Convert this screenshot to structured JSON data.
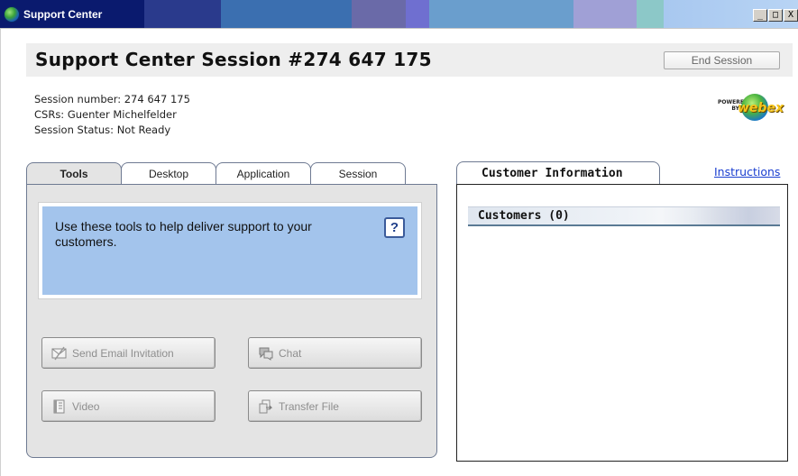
{
  "window": {
    "title": "Support Center",
    "controls": [
      "_",
      "□",
      "X"
    ]
  },
  "header": {
    "title": "Support Center Session #274 647 175",
    "end_session_label": "End Session"
  },
  "session_info": {
    "number_line": "Session number: 274 647 175",
    "csrs_line": "CSRs: Guenter Michelfelder",
    "status_line": "Session Status: Not Ready"
  },
  "logo": {
    "powered": "POWERED BY",
    "brand": "webex"
  },
  "left_tabs": [
    {
      "label": "Tools",
      "active": true
    },
    {
      "label": "Desktop",
      "active": false
    },
    {
      "label": "Application",
      "active": false
    },
    {
      "label": "Session",
      "active": false
    }
  ],
  "tools": {
    "help_text": "Use these tools to help deliver support to your customers.",
    "help_icon": "?",
    "buttons": {
      "email": "Send Email Invitation",
      "chat": "Chat",
      "video": "Video",
      "transfer": "Transfer File"
    }
  },
  "right": {
    "tab_label": "Customer Information",
    "instructions_link": "Instructions",
    "customers_label": "Customers (0)"
  },
  "colors": {
    "help_box": "#a3c4ec",
    "link": "#1a3ed0",
    "panel_bg": "#e4e4e4"
  }
}
